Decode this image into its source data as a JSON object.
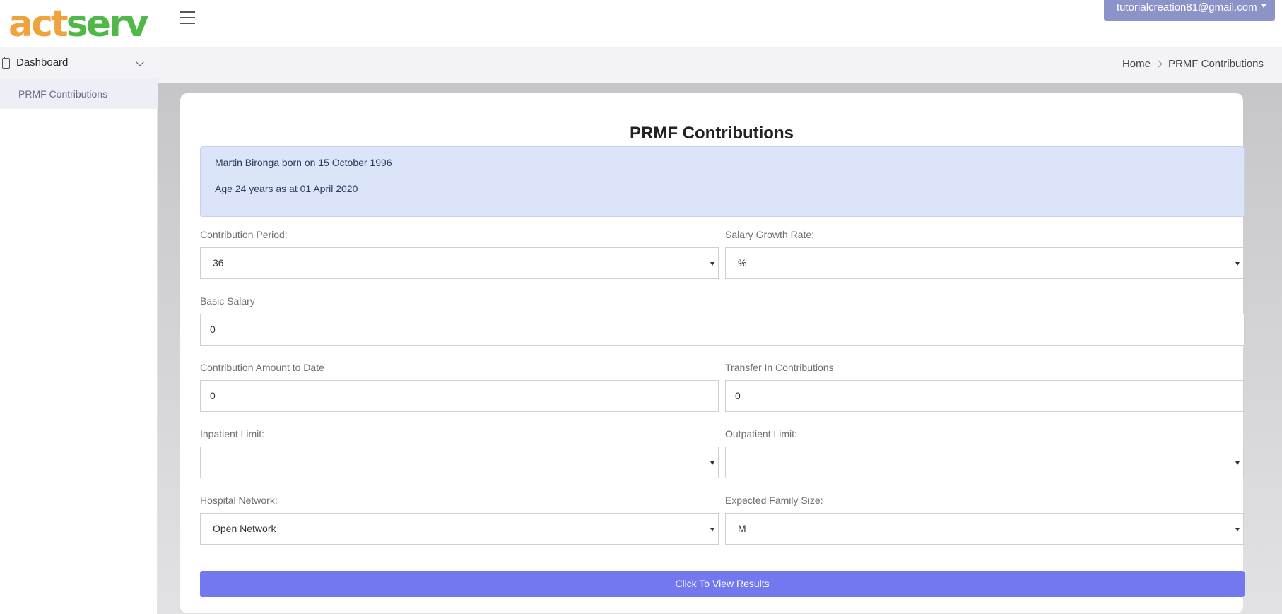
{
  "header": {
    "logo_part1": "act",
    "logo_part2": "serv",
    "user_email": "tutorialcreation81@gmail.com"
  },
  "sidebar": {
    "dashboard_label": "Dashboard",
    "items": [
      {
        "label": "PRMF Contributions"
      }
    ]
  },
  "breadcrumb": {
    "home": "Home",
    "current": "PRMF Contributions"
  },
  "page": {
    "title": "PRMF Contributions",
    "info_line1": "Martin Bironga born on 15 October 1996",
    "info_line2": "Age 24 years as at 01 April 2020"
  },
  "form": {
    "contribution_period": {
      "label": "Contribution Period:",
      "value": "36"
    },
    "salary_growth_rate": {
      "label": "Salary Growth Rate:",
      "value": "%"
    },
    "basic_salary": {
      "label": "Basic Salary",
      "value": "0"
    },
    "contribution_amount": {
      "label": "Contribution Amount to Date",
      "value": "0"
    },
    "transfer_in": {
      "label": "Transfer In Contributions",
      "value": "0"
    },
    "inpatient_limit": {
      "label": "Inpatient Limit:",
      "value": ""
    },
    "outpatient_limit": {
      "label": "Outpatient Limit:",
      "value": ""
    },
    "hospital_network": {
      "label": "Hospital Network:",
      "value": "Open Network"
    },
    "family_size": {
      "label": "Expected Family Size:",
      "value": "M"
    },
    "submit_label": "Click To View Results"
  },
  "colors": {
    "accent": "#7378ee",
    "user_menu": "#8b93c9",
    "info_bg": "#dbe4f9",
    "logo_orange": "#f0a33c",
    "logo_green": "#4fb848"
  }
}
